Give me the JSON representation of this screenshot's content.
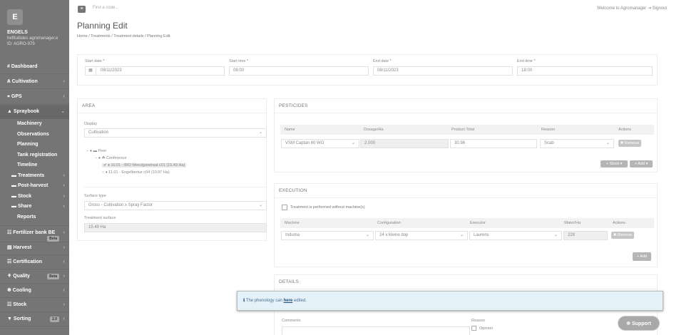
{
  "sidebar": {
    "logo_letter": "E",
    "company": "ENGELS",
    "user": "hefttuibdes agromanager.e",
    "id": "ID: AGRO-979",
    "items": [
      {
        "label": "# Dashboard",
        "chev": ""
      },
      {
        "label": "Ѧ Cultivation",
        "chev": "‹"
      },
      {
        "label": "⌖ GPS",
        "chev": "‹"
      },
      {
        "label": "▲ Spraybook",
        "chev": "⌄"
      }
    ],
    "subitems": [
      {
        "label": "Machinery",
        "chev": ""
      },
      {
        "label": "Observations",
        "chev": ""
      },
      {
        "label": "Planning",
        "chev": ""
      },
      {
        "label": "Tank registration",
        "chev": ""
      },
      {
        "label": "Timeline",
        "chev": ""
      },
      {
        "label": "▬ Treatments",
        "chev": "‹"
      },
      {
        "label": "▬ Post-harvest",
        "chev": "‹"
      },
      {
        "label": "▬ Stock",
        "chev": "‹"
      },
      {
        "label": "▬ Share",
        "chev": "‹"
      },
      {
        "label": "Reports",
        "chev": ""
      }
    ],
    "bottom": [
      {
        "label": "☷ Fertilizer bank BE",
        "badge": "Beta",
        "chev": "‹"
      },
      {
        "label": "▤ Harvest",
        "badge": "",
        "chev": "‹"
      },
      {
        "label": "☶ Certification",
        "badge": "",
        "chev": "‹"
      },
      {
        "label": "⚘ Quality",
        "badge": "Beta",
        "chev": "‹"
      },
      {
        "label": "❄ Cooling",
        "badge": "",
        "chev": "‹"
      },
      {
        "label": "☷ Stock",
        "badge": "",
        "chev": "‹"
      },
      {
        "label": "▼ Sorting",
        "badge": "2.0",
        "chev": "‹"
      }
    ]
  },
  "topbar": {
    "menu_icon": "≡",
    "search_placeholder": "Find a code...",
    "welcome": "Welcome to Agromanager  ⇥ Signout"
  },
  "page": {
    "title": "Planning Edit",
    "breadcrumb": "Home  /  Treatments  /  Treatment details  /  Planning Edit"
  },
  "dates": {
    "start_date_label": "Start date *",
    "start_date_icon": "▦",
    "start_date": "08/11/2023",
    "start_time_label": "Start time *",
    "start_time": "08:00",
    "end_date_label": "End date *",
    "end_date": "08/11/2023",
    "end_time_label": "End time *",
    "end_time": "18:00"
  },
  "area": {
    "title": "AREA",
    "display_label": "Display",
    "display_value": "Cultivation",
    "tree": [
      "− ● ▬ Peer",
      "− ● ☘ Conference",
      "✔ ♦ 10.01 - BIO Weezijpestraat c01 (15.49 Ha)",
      "○ ♦ 11.01 - Engelbertuz c04 (10.97 Ha)"
    ],
    "surface_type_label": "Surface type",
    "surface_type_value": "Gross - Cultivation x Spray Factor",
    "treatment_surface_label": "Treatment surface",
    "treatment_surface_value": "15.49 Ha"
  },
  "pesticides": {
    "title": "PESTICIDES",
    "headers": [
      "Name",
      "Dosage/Ha",
      "Product Total",
      "Reason",
      "Actions"
    ],
    "row": {
      "name": "VSM Captan 80 WG",
      "dosage": "2.000",
      "total": "30.98",
      "reason": "Scab",
      "action": "✖ Remove"
    },
    "stock_btn": "+ Stock ▾",
    "add_btn": "+ Add ▾"
  },
  "execution": {
    "title": "EXECUTION",
    "no_machine_label": "Treatment is performed without machine(s)",
    "headers": [
      "Machine",
      "Configuration",
      "Executor",
      "Water/Ha",
      "Actions"
    ],
    "row": {
      "machine": "Induma",
      "configuration": "24 x kleine dop",
      "executor": "Laurens",
      "water": "228",
      "action": "✖ Remove"
    },
    "add_btn": "+ Add"
  },
  "details": {
    "title": "DETAILS",
    "comments_label": "Comments",
    "reason_label": "Reason",
    "opinion_label": "Opinion"
  },
  "alert": {
    "icon": "ℹ",
    "text_before": "The phenology can ",
    "link": "here",
    "text_after": " edited."
  },
  "support": {
    "label": "✲ Support"
  }
}
